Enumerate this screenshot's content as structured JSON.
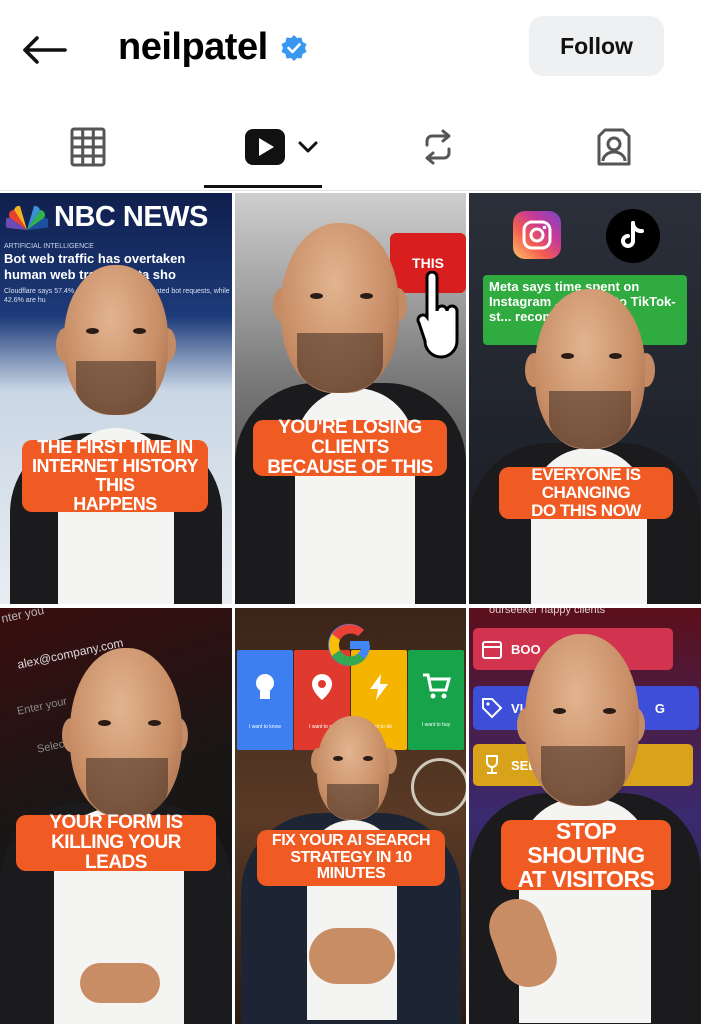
{
  "header": {
    "username": "neilpatel",
    "follow_label": "Follow"
  },
  "tabs": [
    {
      "name": "posts",
      "icon": "grid-icon",
      "active": false
    },
    {
      "name": "reels",
      "icon": "reels-icon",
      "active": true
    },
    {
      "name": "reposts",
      "icon": "repost-icon",
      "active": false
    },
    {
      "name": "tagged",
      "icon": "tagged-icon",
      "active": false
    }
  ],
  "colors": {
    "verified": "#3897f0",
    "caption": "#f05a23",
    "active_underline": "#111111"
  },
  "posts": [
    {
      "caption_lines": [
        "THE FIRST TIME IN",
        "INTERNET HISTORY THIS",
        "HAPPENS"
      ],
      "news_brand": "NBC NEWS",
      "news_kicker": "ARTIFICIAL INTELLIGENCE",
      "news_headline": "Bot web traffic has overtaken human web traffic, data sho",
      "news_body": "Cloudflare says 57.4% of reque... are now automated bot requests, while 42.6% are hu"
    },
    {
      "caption_lines": [
        "YOU'RE LOSING CLIENTS",
        "BECAUSE OF THIS"
      ],
      "sign_text": "THIS"
    },
    {
      "caption_lines": [
        "EVERYONE IS CHANGING",
        "DO THIS NOW"
      ],
      "card_text": "Meta says time spent on Instagram ... thanks to TikTok-st... recomm"
    },
    {
      "caption_lines": [
        "YOUR FORM IS",
        "KILLING YOUR LEADS"
      ],
      "form_email": "alex@company.com",
      "form_placeholder": "Enter your",
      "form_top": "nter you",
      "form_select": "Select"
    },
    {
      "caption_lines": [
        "FIX YOUR AI SEARCH",
        "STRATEGY IN 10 MINUTES"
      ],
      "tiles": [
        {
          "color": "#3d7ef0",
          "label": "I want to know"
        },
        {
          "color": "#e03a2f",
          "label": "I want to go"
        },
        {
          "color": "#f4b400",
          "label": "I want to do"
        },
        {
          "color": "#16a34a",
          "label": "I want to buy"
        }
      ]
    },
    {
      "caption_lines": [
        "STOP SHOUTING",
        "AT VISITORS"
      ],
      "top_text": "ourseeker happy clients",
      "buttons": [
        "BOO",
        "VI",
        "SEE C"
      ],
      "side_letter": "G"
    }
  ]
}
